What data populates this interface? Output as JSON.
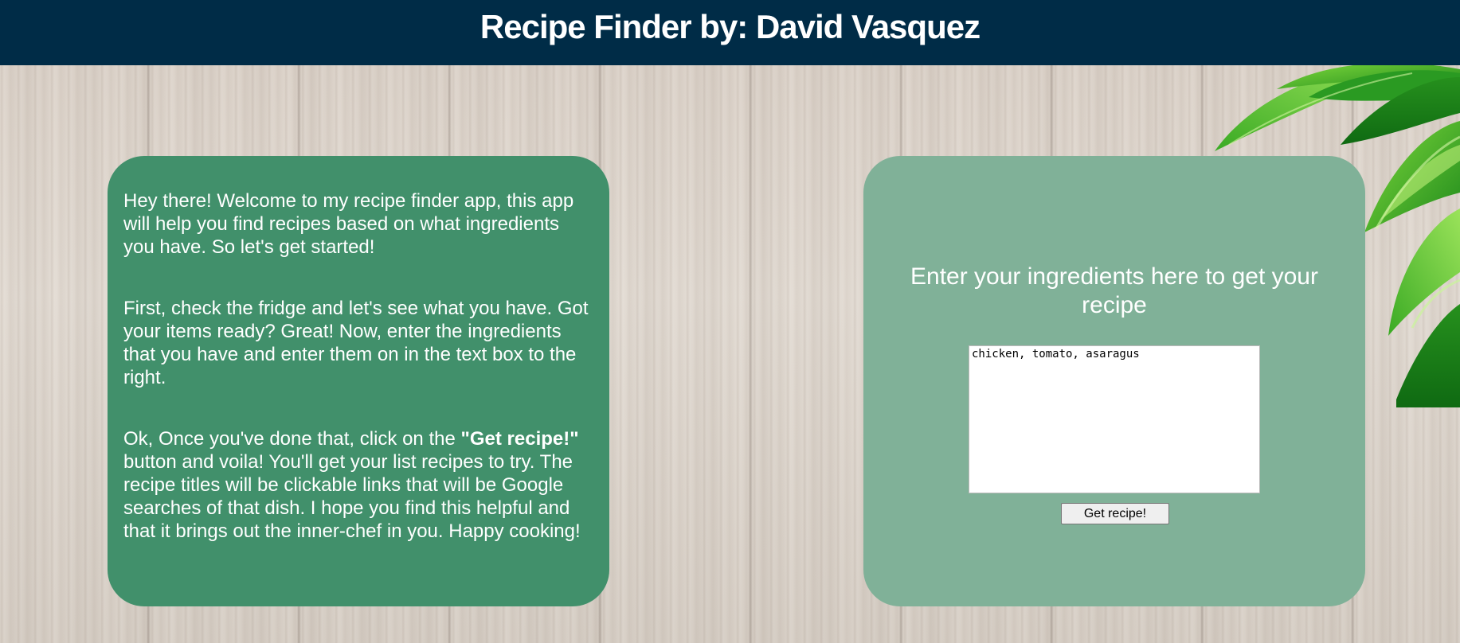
{
  "header": {
    "title": "Recipe Finder by: David Vasquez"
  },
  "intro": {
    "paragraph1": "Hey there! Welcome to my recipe finder app, this app will help you find recipes based on what ingredients you have. So let's get started!",
    "paragraph2": "First, check the fridge and let's see what you have. Got your items ready? Great! Now, enter the ingredients that you have and enter them on in the text box to the right.",
    "paragraph3_before": "Ok, Once you've done that, click on the ",
    "paragraph3_bold": "\"Get recipe!\"",
    "paragraph3_after": " button and voila! You'll get your list recipes to try. The recipe titles will be clickable links that will be Google searches of that dish. I hope you find this helpful and that it brings out the inner-chef in you. Happy cooking!"
  },
  "finder": {
    "prompt": "Enter your ingredients here to get your recipe",
    "ingredients_value": "chicken, tomato, asaragus",
    "button_label": "Get recipe!"
  },
  "colors": {
    "header_bg": "#002c47",
    "info_panel_bg": "#41906b",
    "input_panel_bg": "#80b198",
    "text": "#ffffff"
  },
  "icons": {
    "decoration": "green-leaves"
  }
}
